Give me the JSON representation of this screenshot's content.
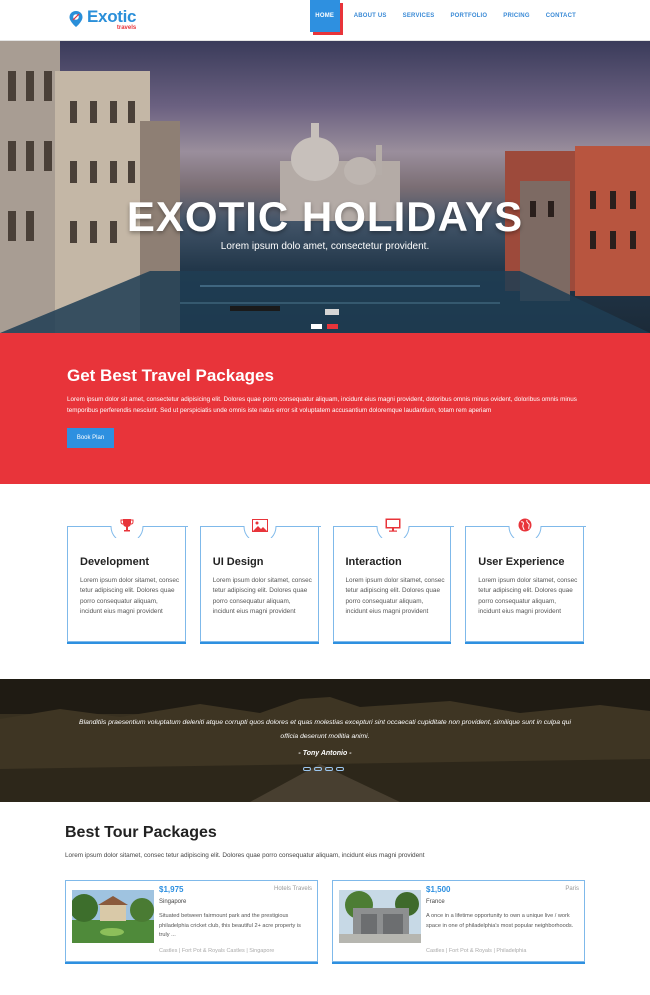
{
  "header": {
    "logo_main": "Exotic",
    "logo_sub": "travels",
    "nav": [
      "HOME",
      "ABOUT US",
      "SERVICES",
      "PORTFOLIO",
      "PRICING",
      "CONTACT"
    ]
  },
  "hero": {
    "title": "EXOTIC HOLIDAYS",
    "subtitle": "Lorem ipsum dolo amet, consectetur provident.",
    "slides": 2,
    "active_slide": 2
  },
  "packages_band": {
    "title": "Get Best Travel Packages",
    "text": "Lorem ipsum dolor sit amet, consectetur adipisicing elit. Dolores quae porro consequatur aliquam, incidunt eius magni provident, doloribus omnis minus ovident, doloribus omnis minus temporibus perferendis nesciunt. Sed ut perspiciatis unde omnis iste natus error sit voluptatem accusantium doloremque laudantium, totam rem aperiam",
    "button": "Book Plan"
  },
  "services": [
    {
      "icon": "trophy-icon",
      "title": "Development",
      "text": "Lorem ipsum dolor sitamet, consec tetur adipiscing elit. Dolores quae porro consequatur aliquam, incidunt eius magni provident"
    },
    {
      "icon": "image-icon",
      "title": "UI Design",
      "text": "Lorem ipsum dolor sitamet, consec tetur adipiscing elit. Dolores quae porro consequatur aliquam, incidunt eius magni provident"
    },
    {
      "icon": "monitor-icon",
      "title": "Interaction",
      "text": "Lorem ipsum dolor sitamet, consec tetur adipiscing elit. Dolores quae porro consequatur aliquam, incidunt eius magni provident"
    },
    {
      "icon": "globe-icon",
      "title": "User Experience",
      "text": "Lorem ipsum dolor sitamet, consec tetur adipiscing elit. Dolores quae porro consequatur aliquam, incidunt eius magni provident"
    }
  ],
  "testimonial": {
    "quote": "Blanditiis praesentium voluptatum deleniti atque corrupti quos dolores et quas molestias excepturi sint occaecati cupiditate non provident, similique sunt in culpa qui officia deserunt mollitia animi.",
    "author": "- Tony Antonio -",
    "dots": 4
  },
  "tours": {
    "title": "Best Tour Packages",
    "description": "Lorem ipsum dolor sitamet, consec tetur adipiscing elit. Dolores quae porro consequatur aliquam, incidunt eius magni provident",
    "items": [
      {
        "price": "$1,975",
        "place": "Singapore",
        "tag": "Hotels Travels",
        "text": "Situated between fairmount park and the prestigious philadelphia cricket club, this beautiful 2+ acre property is truly ...",
        "meta": "Castles | Fort Pot & Royals Castles | Singapore"
      },
      {
        "price": "$1,500",
        "place": "France",
        "tag": "Paris",
        "text": "A once in a lifetime opportunity to own a unique live / work space in one of philadelphia's most popular neighborhoods.",
        "meta": "Castles | Fort Pot & Royals | Philadelphia"
      }
    ]
  },
  "colors": {
    "accent_blue": "#2e90e0",
    "accent_red": "#e8343a"
  }
}
